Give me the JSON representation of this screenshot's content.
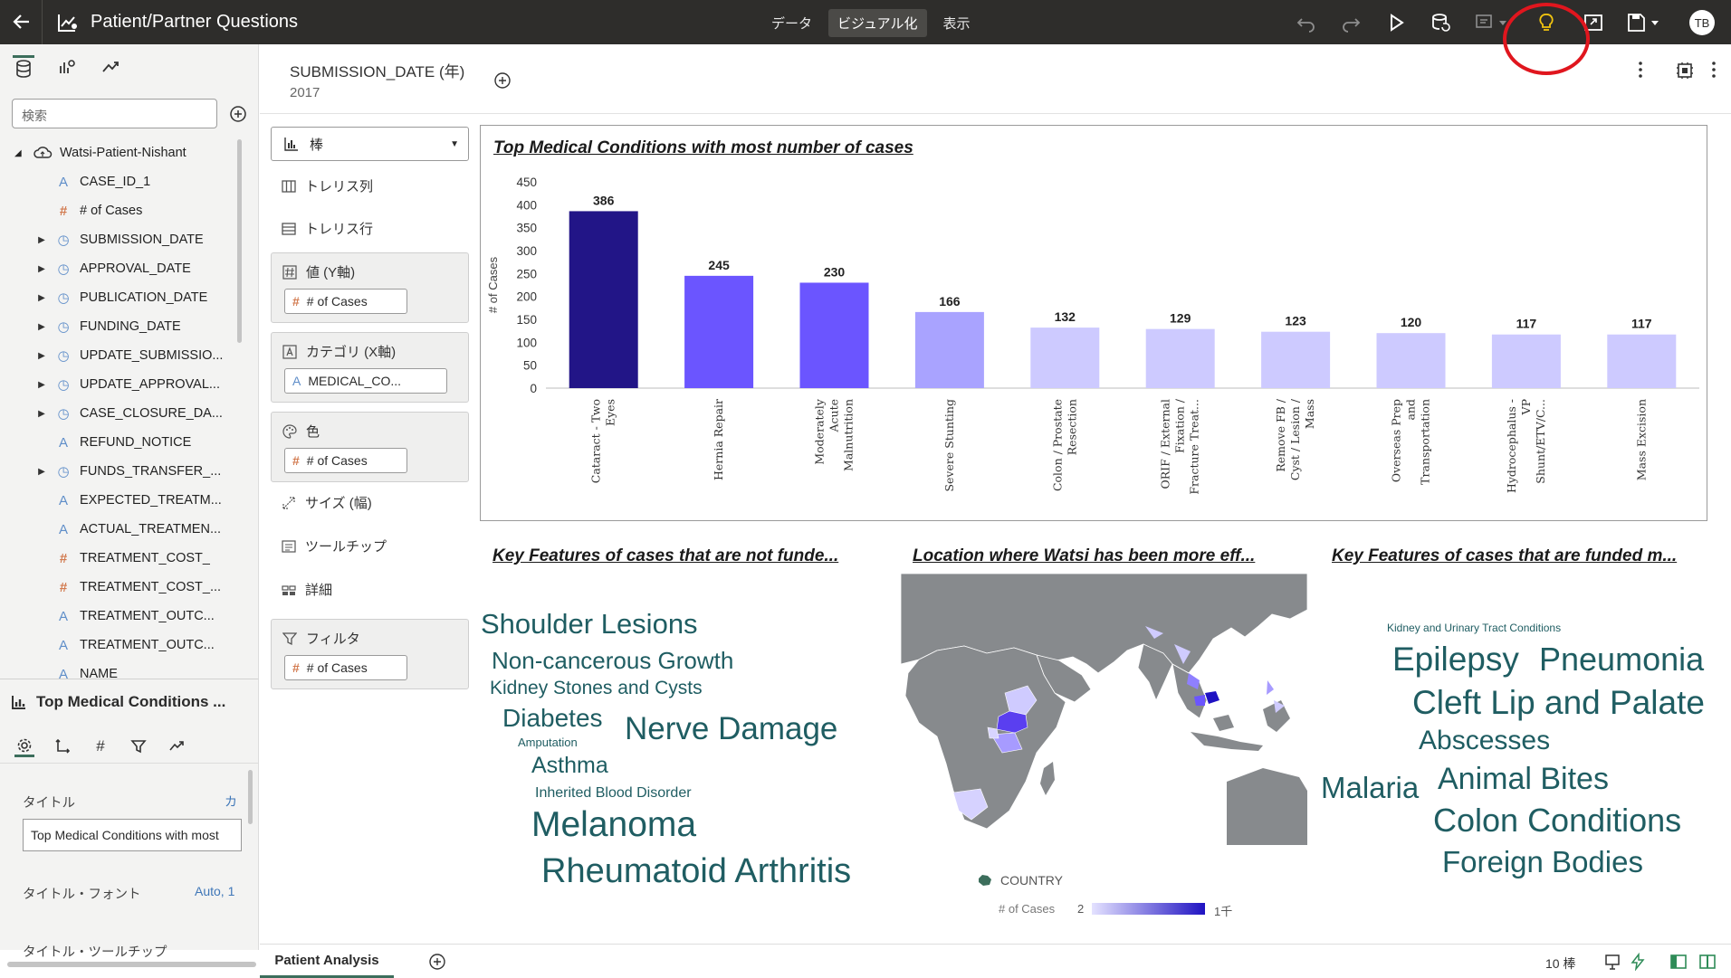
{
  "topbar": {
    "title": "Patient/Partner Questions",
    "modes": [
      "データ",
      "ビジュアル化",
      "表示"
    ],
    "active_mode": "ビジュアル化",
    "avatar": "TB",
    "highlight_color": "#e0161e"
  },
  "data_panel": {
    "search_placeholder": "検索",
    "source": "Watsi-Patient-Nishant",
    "columns": [
      {
        "name": "CASE_ID_1",
        "kind": "attr",
        "expand": false
      },
      {
        "name": "# of Cases",
        "kind": "meas",
        "expand": false
      },
      {
        "name": "SUBMISSION_DATE",
        "kind": "time",
        "expand": true
      },
      {
        "name": "APPROVAL_DATE",
        "kind": "time",
        "expand": true
      },
      {
        "name": "PUBLICATION_DATE",
        "kind": "time",
        "expand": true
      },
      {
        "name": "FUNDING_DATE",
        "kind": "time",
        "expand": true
      },
      {
        "name": "UPDATE_SUBMISSIO...",
        "kind": "time",
        "expand": true
      },
      {
        "name": "UPDATE_APPROVAL...",
        "kind": "time",
        "expand": true
      },
      {
        "name": "CASE_CLOSURE_DA...",
        "kind": "time",
        "expand": true
      },
      {
        "name": "REFUND_NOTICE",
        "kind": "attr",
        "expand": false
      },
      {
        "name": "FUNDS_TRANSFER_...",
        "kind": "time",
        "expand": true
      },
      {
        "name": "EXPECTED_TREATM...",
        "kind": "attr",
        "expand": false
      },
      {
        "name": "ACTUAL_TREATMEN...",
        "kind": "attr",
        "expand": false
      },
      {
        "name": "TREATMENT_COST_",
        "kind": "meas",
        "expand": false
      },
      {
        "name": "TREATMENT_COST_...",
        "kind": "meas",
        "expand": false
      },
      {
        "name": "TREATMENT_OUTC...",
        "kind": "attr",
        "expand": false
      },
      {
        "name": "TREATMENT_OUTC...",
        "kind": "attr",
        "expand": false
      },
      {
        "name": "NAME",
        "kind": "attr",
        "expand": false
      }
    ]
  },
  "properties": {
    "viz_name": "Top Medical Conditions ...",
    "title_label": "タイトル",
    "title_value_short": "カ",
    "title_input": "Top Medical Conditions with most",
    "font_label": "タイトル・フォント",
    "font_value": "Auto, 1",
    "tooltip_label": "タイトル・ツールチップ"
  },
  "filterbar": {
    "name": "SUBMISSION_DATE (年)",
    "value": "2017"
  },
  "grammar": {
    "viz_type": "棒",
    "trellis_cols": "トレリス列",
    "trellis_rows": "トレリス行",
    "values_label": "値 (Y軸)",
    "values_item": "# of Cases",
    "category_label": "カテゴリ (X軸)",
    "category_item": "MEDICAL_CO...",
    "color_label": "色",
    "color_item": "# of Cases",
    "size_label": "サイズ (幅)",
    "tooltip_label": "ツールチップ",
    "detail_label": "詳細",
    "filter_label": "フィルタ",
    "filter_item": "# of Cases"
  },
  "bar_viz": {
    "title": "Top Medical Conditions with most number of cases"
  },
  "chart_data": {
    "type": "bar",
    "title": "Top Medical Conditions with most number of cases",
    "ylabel": "# of Cases",
    "xlabel": "",
    "ylim": [
      0,
      450
    ],
    "yticks": [
      0,
      50,
      100,
      150,
      200,
      250,
      300,
      350,
      400,
      450
    ],
    "categories": [
      [
        "Cataract - Two",
        "Eyes"
      ],
      [
        "Hernia Repair"
      ],
      [
        "Moderately",
        "Acute",
        "Malnutrition"
      ],
      [
        "Severe Stunting"
      ],
      [
        "Colon / Prostate",
        "Resection"
      ],
      [
        "ORIF / External",
        "Fixation /",
        "Fracture Treat..."
      ],
      [
        "Remove FB /",
        "Cyst / Lesion /",
        "Mass"
      ],
      [
        "Overseas Prep",
        "and",
        "Transportation"
      ],
      [
        "Hydrocephalus -",
        "VP",
        "Shunt/ETV/C..."
      ],
      [
        "Mass Excision"
      ]
    ],
    "values": [
      386,
      245,
      230,
      166,
      132,
      129,
      123,
      120,
      117,
      117
    ],
    "colors": [
      "#221587",
      "#6b55ff",
      "#6b55ff",
      "#a9a3ff",
      "#cdcaff",
      "#cdcaff",
      "#cdcaff",
      "#cdcaff",
      "#cdcaff",
      "#cdcaff"
    ]
  },
  "cloud_left": {
    "title": "Key Features of cases that are not funde...",
    "words": [
      "Shoulder Lesions",
      "Non-cancerous Growth",
      "Kidney Stones and Cysts",
      "Diabetes",
      "Amputation",
      "Nerve Damage",
      "Asthma",
      "Inherited Blood Disorder",
      "Melanoma",
      "Rheumatoid Arthritis"
    ]
  },
  "map_viz": {
    "title": "Location where Watsi has been more eff...",
    "legend_layer": "COUNTRY",
    "legend_measure": "# of Cases",
    "legend_min": "2",
    "legend_max": "1千",
    "land_color": "#878a8d",
    "ramp_start": "#e4e2ff",
    "ramp_end": "#1f12c2"
  },
  "cloud_right": {
    "title": "Key Features of cases that are funded m...",
    "words": [
      "Kidney and Urinary Tract Conditions",
      "Epilepsy",
      "Pneumonia",
      "Cleft Lip and Palate",
      "Abscesses",
      "Malaria",
      "Animal Bites",
      "Colon Conditions",
      "Foreign Bodies"
    ]
  },
  "bottombar": {
    "tab": "Patient Analysis",
    "count": "10 棒"
  }
}
